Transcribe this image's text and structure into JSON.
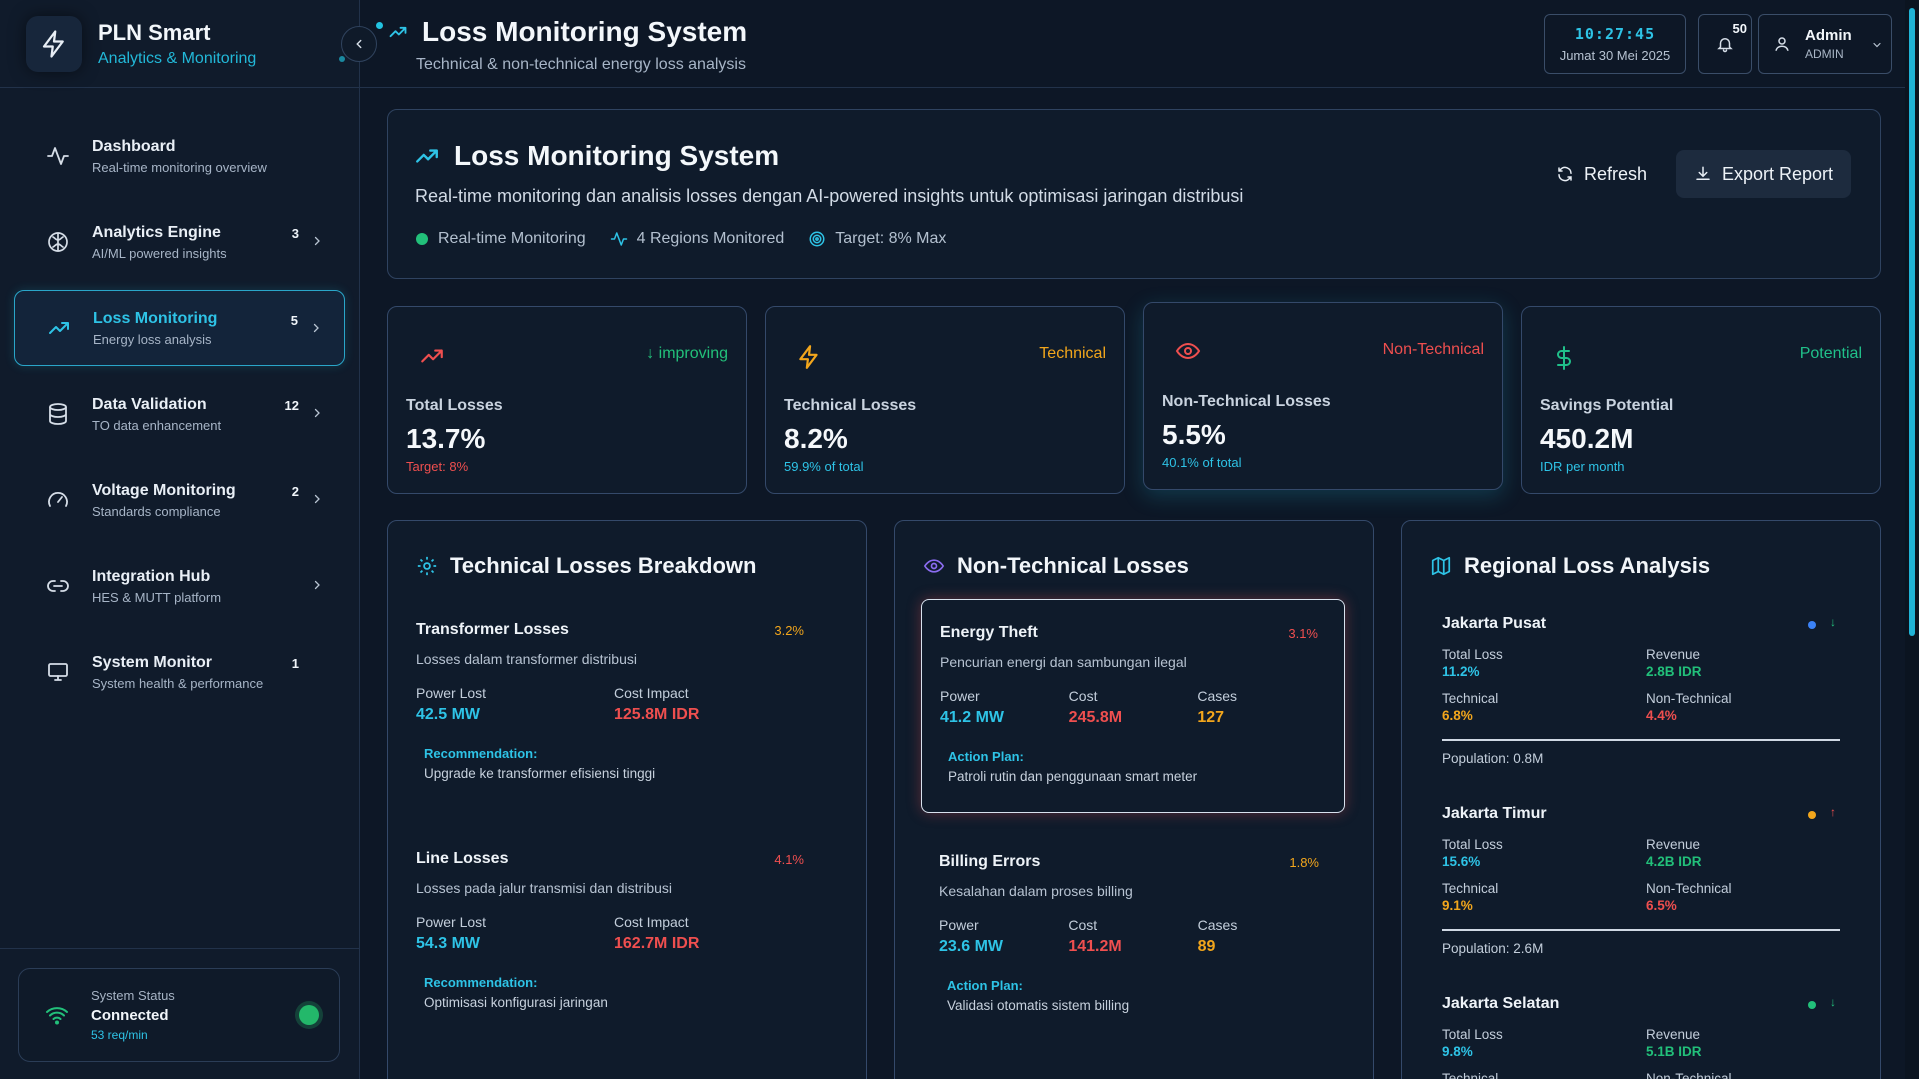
{
  "brand": {
    "title": "PLN Smart",
    "subtitle": "Analytics & Monitoring"
  },
  "sidebar": {
    "items": [
      {
        "label": "Dashboard",
        "sub": "Real-time monitoring overview",
        "badge": "",
        "icon": "activity-icon"
      },
      {
        "label": "Analytics Engine",
        "sub": "AI/ML powered insights",
        "badge": "3",
        "icon": "brain-icon"
      },
      {
        "label": "Loss Monitoring",
        "sub": "Energy loss analysis",
        "badge": "5",
        "icon": "trending-up-icon"
      },
      {
        "label": "Data Validation",
        "sub": "TO data enhancement",
        "badge": "12",
        "icon": "database-icon"
      },
      {
        "label": "Voltage Monitoring",
        "sub": "Standards compliance",
        "badge": "2",
        "icon": "gauge-icon"
      },
      {
        "label": "Integration Hub",
        "sub": "HES & MUTT platform",
        "badge": "",
        "icon": "link-icon"
      },
      {
        "label": "System Monitor",
        "sub": "System health & performance",
        "badge": "1",
        "icon": "monitor-icon"
      }
    ],
    "status": {
      "label": "System Status",
      "value": "Connected",
      "rate": "53 req/min"
    }
  },
  "header": {
    "title": "Loss Monitoring System",
    "subtitle": "Technical & non-technical energy loss analysis",
    "time": "10:27:45",
    "date": "Jumat 30 Mei 2025",
    "notifications": "50",
    "user_name": "Admin",
    "user_role": "ADMIN"
  },
  "hero": {
    "title": "Loss Monitoring System",
    "description": "Real-time monitoring dan analisis losses dengan AI-powered insights untuk optimisasi jaringan distribusi",
    "tags": [
      "Real-time Monitoring",
      "4 Regions Monitored",
      "Target: 8% Max"
    ],
    "refresh_label": "Refresh",
    "export_label": "Export Report"
  },
  "kpis": [
    {
      "tag": "↓ improving",
      "label": "Total Losses",
      "value": "13.7%",
      "note": "Target: 8%"
    },
    {
      "tag": "Technical",
      "label": "Technical Losses",
      "value": "8.2%",
      "note": "59.9% of total"
    },
    {
      "tag": "Non-Technical",
      "label": "Non-Technical Losses",
      "value": "5.5%",
      "note": "40.1% of total"
    },
    {
      "tag": "Potential",
      "label": "Savings Potential",
      "value": "450.2M",
      "note": "IDR per month"
    }
  ],
  "technical": {
    "title": "Technical Losses Breakdown",
    "items": [
      {
        "name": "Transformer Losses",
        "pct": "3.2%",
        "desc": "Losses dalam transformer distribusi",
        "power_label": "Power Lost",
        "power": "42.5 MW",
        "cost_label": "Cost Impact",
        "cost": "125.8M IDR",
        "rec_label": "Recommendation:",
        "rec": "Upgrade ke transformer efisiensi tinggi"
      },
      {
        "name": "Line Losses",
        "pct": "4.1%",
        "desc": "Losses pada jalur transmisi dan distribusi",
        "power_label": "Power Lost",
        "power": "54.3 MW",
        "cost_label": "Cost Impact",
        "cost": "162.7M IDR",
        "rec_label": "Recommendation:",
        "rec": "Optimisasi konfigurasi jaringan"
      }
    ]
  },
  "nontechnical": {
    "title": "Non-Technical Losses",
    "items": [
      {
        "name": "Energy Theft",
        "pct": "3.1%",
        "desc": "Pencurian energi dan sambungan ilegal",
        "power_label": "Power",
        "power": "41.2 MW",
        "cost_label": "Cost",
        "cost": "245.8M",
        "cases_label": "Cases",
        "cases": "127",
        "plan_label": "Action Plan:",
        "plan": "Patroli rutin dan penggunaan smart meter"
      },
      {
        "name": "Billing Errors",
        "pct": "1.8%",
        "desc": "Kesalahan dalam proses billing",
        "power_label": "Power",
        "power": "23.6 MW",
        "cost_label": "Cost",
        "cost": "141.2M",
        "cases_label": "Cases",
        "cases": "89",
        "plan_label": "Action Plan:",
        "plan": "Validasi otomatis sistem billing"
      }
    ]
  },
  "regional": {
    "title": "Regional Loss Analysis",
    "labels": {
      "total": "Total Loss",
      "revenue": "Revenue",
      "technical": "Technical",
      "nontechnical": "Non-Technical"
    },
    "items": [
      {
        "name": "Jakarta Pusat",
        "trend": "↓",
        "dot_color": "#3b82f6",
        "total": "11.2%",
        "revenue": "2.8B IDR",
        "technical": "6.8%",
        "nontechnical": "4.4%",
        "population": "Population: 0.8M"
      },
      {
        "name": "Jakarta Timur",
        "trend": "↑",
        "dot_color": "#f2a61c",
        "total": "15.6%",
        "revenue": "4.2B IDR",
        "technical": "9.1%",
        "nontechnical": "6.5%",
        "population": "Population: 2.6M"
      },
      {
        "name": "Jakarta Selatan",
        "trend": "↓",
        "dot_color": "#22c07a",
        "total": "9.8%",
        "revenue": "5.1B IDR",
        "technical": "",
        "nontechnical": "",
        "population": ""
      }
    ]
  },
  "colors": {
    "accent": "#2ec3e6",
    "danger": "#ef4f4f",
    "success": "#22c07a",
    "warning": "#f2a61c",
    "background": "#0d1726"
  }
}
